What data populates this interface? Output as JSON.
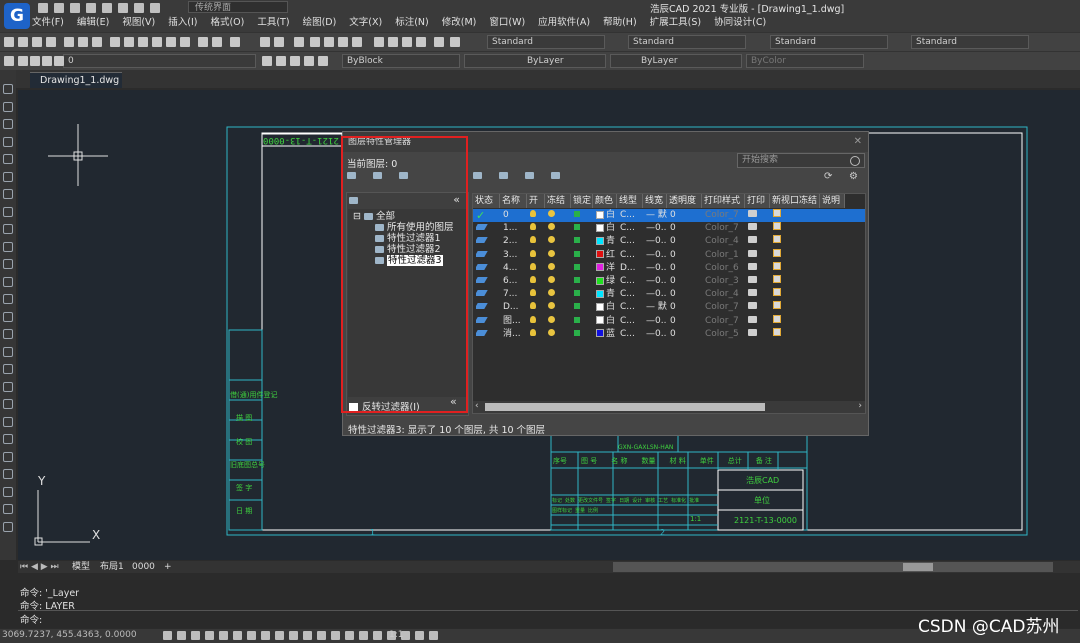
{
  "app": {
    "title": "浩辰CAD 2021 专业版 - [Drawing1_1.dwg]",
    "workspace": "传统界面",
    "logo_letter": "G"
  },
  "menu": [
    "文件(F)",
    "编辑(E)",
    "视图(V)",
    "插入(I)",
    "格式(O)",
    "工具(T)",
    "绘图(D)",
    "文字(X)",
    "标注(N)",
    "修改(M)",
    "窗口(W)",
    "应用软件(A)",
    "帮助(H)",
    "扩展工具(S)",
    "协同设计(C)"
  ],
  "toolbar": {
    "styles": [
      "Standard",
      "Standard",
      "Standard",
      "Standard"
    ],
    "layer_combo": "0",
    "color_combo": "ByBlock",
    "linetype_combo": "ByLayer",
    "lineweight_combo": "ByLayer",
    "plotstyle_combo": "ByColor"
  },
  "document_tab": "Drawing1_1.dwg",
  "drawing": {
    "titleblock_number": "2121-T-13-0000",
    "company": "浩辰CAD",
    "unit": "单位",
    "side_labels": [
      "借(通)用件登记",
      "描 图",
      "校 图",
      "旧底图总号",
      "签 字",
      "日 期"
    ],
    "table_headers": [
      "序号",
      "图 号",
      "名 称",
      "数量",
      "材 料",
      "单件",
      "总计",
      "备 注"
    ],
    "mid_text": "GXN-GAXLSN-HAN",
    "small_cells": [
      "标记",
      "处数",
      "更改文件号",
      "签字",
      "日期",
      "设计",
      "审核",
      "工艺",
      "标准化",
      "批准",
      "图样标记",
      "重量",
      "比例"
    ],
    "scale_text": "1:1",
    "col_numbers": [
      "1",
      "2"
    ],
    "axis_y": "Y",
    "axis_x": "X"
  },
  "dialog": {
    "title": "图层特性管理器",
    "current_layer": "当前图层: 0",
    "search_placeholder": "开始搜索",
    "tree": [
      "全部",
      "所有使用的图层",
      "特性过滤器1",
      "特性过滤器2",
      "特性过滤器3"
    ],
    "invert_filter": "反转过滤器(I)",
    "collapse": "«",
    "headers": [
      "状态",
      "名称",
      "开",
      "冻结",
      "锁定",
      "颜色",
      "线型",
      "线宽",
      "透明度",
      "打印样式",
      "打印",
      "新视口冻结",
      "说明"
    ],
    "rows": [
      {
        "name": "0",
        "color": "#ffffff",
        "color_label": "白",
        "linetype": "C...",
        "lineweight": "— 默...",
        "transparency": "0",
        "plotstyle": "Color_7",
        "selected": true
      },
      {
        "name": "1...",
        "color": "#ffffff",
        "color_label": "白",
        "linetype": "C...",
        "lineweight": "—0...",
        "transparency": "0",
        "plotstyle": "Color_7",
        "selected": false
      },
      {
        "name": "2...",
        "color": "#00e5ff",
        "color_label": "青",
        "linetype": "C...",
        "lineweight": "—0...",
        "transparency": "0",
        "plotstyle": "Color_4",
        "selected": false
      },
      {
        "name": "3...",
        "color": "#e01010",
        "color_label": "红",
        "linetype": "C...",
        "lineweight": "—0...",
        "transparency": "0",
        "plotstyle": "Color_1",
        "selected": false
      },
      {
        "name": "4...",
        "color": "#e020e0",
        "color_label": "洋",
        "linetype": "D...",
        "lineweight": "—0...",
        "transparency": "0",
        "plotstyle": "Color_6",
        "selected": false
      },
      {
        "name": "6...",
        "color": "#20e020",
        "color_label": "绿",
        "linetype": "C...",
        "lineweight": "—0...",
        "transparency": "0",
        "plotstyle": "Color_3",
        "selected": false
      },
      {
        "name": "7...",
        "color": "#00e5ff",
        "color_label": "青",
        "linetype": "C...",
        "lineweight": "—0...",
        "transparency": "0",
        "plotstyle": "Color_4",
        "selected": false
      },
      {
        "name": "D...",
        "color": "#ffffff",
        "color_label": "白",
        "linetype": "C...",
        "lineweight": "— 默...",
        "transparency": "0",
        "plotstyle": "Color_7",
        "selected": false
      },
      {
        "name": "图...",
        "color": "#ffffff",
        "color_label": "白",
        "linetype": "C...",
        "lineweight": "—0...",
        "transparency": "0",
        "plotstyle": "Color_7",
        "selected": false
      },
      {
        "name": "消...",
        "color": "#1010e0",
        "color_label": "蓝",
        "linetype": "C...",
        "lineweight": "—0...",
        "transparency": "0",
        "plotstyle": "Color_5",
        "selected": false
      }
    ],
    "status": "特性过滤器3: 显示了 10 个图层, 共 10 个图层"
  },
  "layout_tabs": [
    "模型",
    "布局1",
    "0000",
    "+"
  ],
  "command": {
    "lines": [
      "命令: '_Layer",
      "命令: LAYER",
      "命令:"
    ]
  },
  "status": {
    "coordinates": "3069.7237, 455.4363, 0.0000",
    "scale": "1:1"
  },
  "watermark": "CSDN @CAD苏州"
}
